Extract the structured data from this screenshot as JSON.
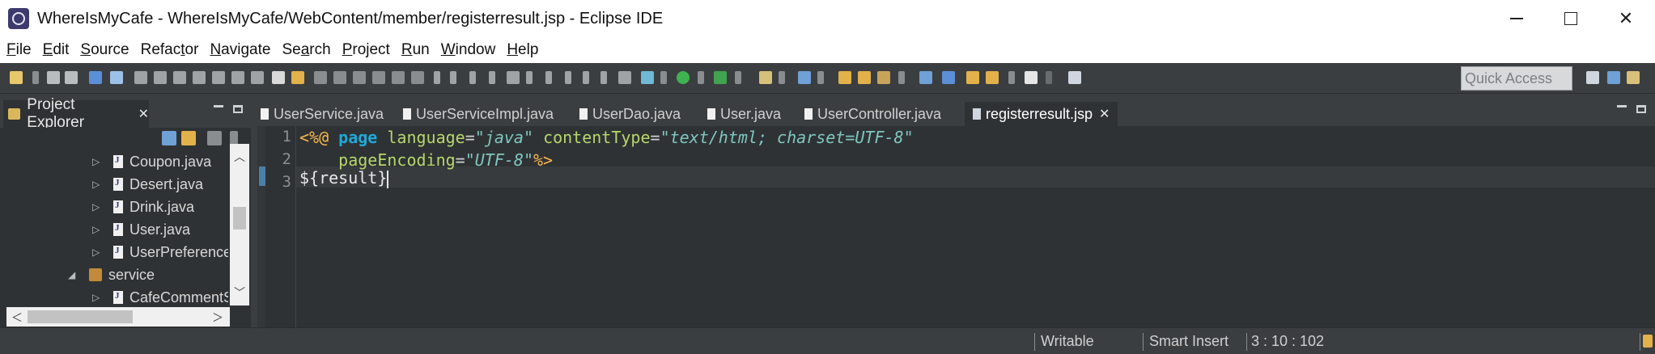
{
  "window": {
    "title": "WhereIsMyCafe - WhereIsMyCafe/WebContent/member/registerresult.jsp - Eclipse IDE",
    "controls": {
      "minimize": "",
      "maximize": "",
      "close": "✕"
    }
  },
  "menu": {
    "items": [
      {
        "mn": "F",
        "rest": "ile"
      },
      {
        "mn": "E",
        "rest": "dit"
      },
      {
        "mn": "S",
        "rest": "ource"
      },
      {
        "pre": "Refac",
        "mn": "t",
        "rest": "or"
      },
      {
        "mn": "N",
        "rest": "avigate"
      },
      {
        "pre": "Se",
        "mn": "a",
        "rest": "rch"
      },
      {
        "mn": "P",
        "rest": "roject"
      },
      {
        "mn": "R",
        "rest": "un"
      },
      {
        "mn": "W",
        "rest": "indow"
      },
      {
        "mn": "H",
        "rest": "elp"
      }
    ]
  },
  "toolbar": {
    "quick_access_placeholder": "Quick Access"
  },
  "explorer": {
    "tab_label": "Project Explorer",
    "tab_close": "✕",
    "tree": [
      {
        "label": "Coupon.java",
        "kind": "java"
      },
      {
        "label": "Desert.java",
        "kind": "java"
      },
      {
        "label": "Drink.java",
        "kind": "java"
      },
      {
        "label": "User.java",
        "kind": "java"
      },
      {
        "label": "UserPreferenceE",
        "kind": "java"
      },
      {
        "label": "service",
        "kind": "package"
      },
      {
        "label": "CafeCommentSe",
        "kind": "java"
      }
    ],
    "arrows": {
      "collapsed": "▷",
      "expanded": "◢",
      "up": "︿",
      "down": "﹀",
      "left": "＜",
      "right": "＞"
    }
  },
  "editor": {
    "tabs": [
      {
        "label": "UserService.java"
      },
      {
        "label": "UserServiceImpl.java"
      },
      {
        "label": "UserDao.java"
      },
      {
        "label": "User.java"
      },
      {
        "label": "UserController.java"
      },
      {
        "label": "registerresult.jsp",
        "active": true
      }
    ],
    "active_tab_close": "✕",
    "line_numbers": [
      "1",
      "2",
      "3"
    ],
    "code": {
      "l1_open": "<%@",
      "l1_page": "page",
      "l1_lang_attr": "language",
      "l1_eq1": "=",
      "l1_lang_val": "\"java\"",
      "l1_ct_attr": "contentType",
      "l1_eq2": "=",
      "l1_ct_val": "\"text/html; charset=UTF-8\"",
      "l2_pe_attr": "pageEncoding",
      "l2_eq": "=",
      "l2_pe_val": "\"UTF-8\"",
      "l2_close": "%>",
      "l3_text": "${result}"
    }
  },
  "status": {
    "writable": "Writable",
    "insert_mode": "Smart Insert",
    "position": "3 : 10 : 102"
  }
}
